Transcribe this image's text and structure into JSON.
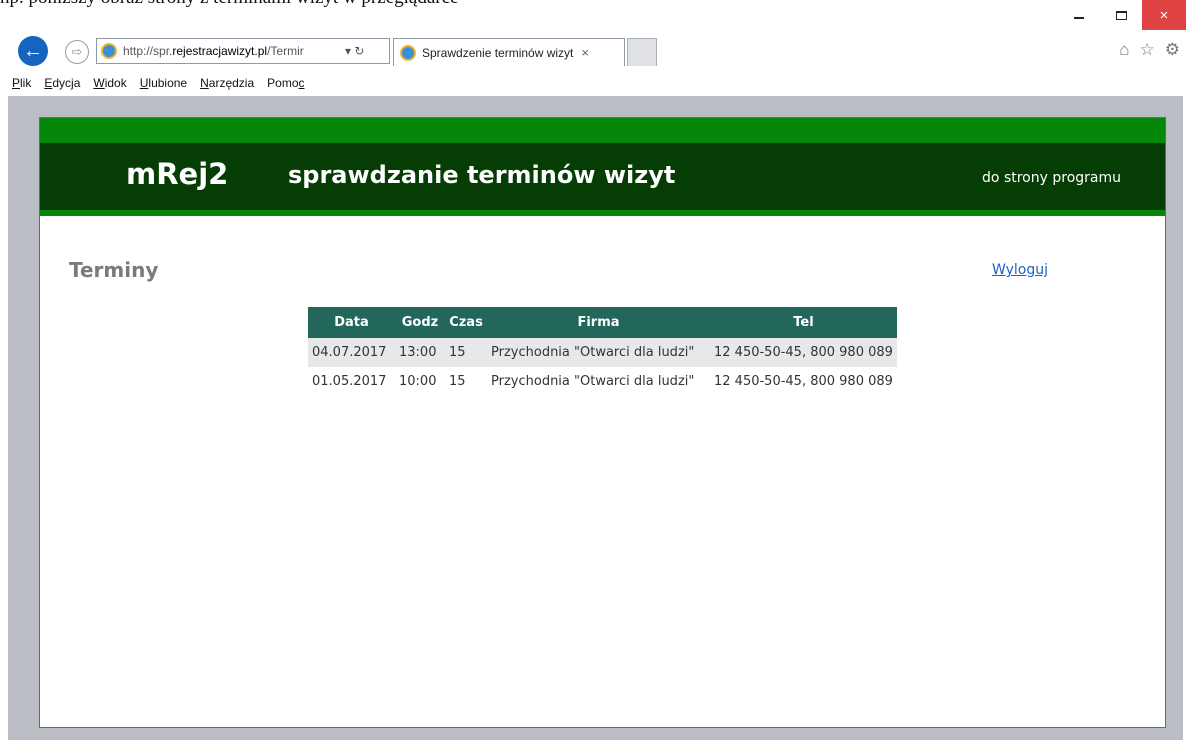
{
  "doc_caption": "np. poniższy obraz strony z terminami wizyt w przeglądarce",
  "browser": {
    "url_prefix": "http://spr.",
    "url_domain": "rejestracjawizyt.pl",
    "url_suffix": "/Termir",
    "address_icons": "▾ ↻",
    "tab_title": "Sprawdzenie terminów wizyt",
    "tab_close": "×",
    "window_close": "×",
    "menu": [
      {
        "pre": "",
        "key": "P",
        "post": "lik"
      },
      {
        "pre": "",
        "key": "E",
        "post": "dycja"
      },
      {
        "pre": "",
        "key": "W",
        "post": "idok"
      },
      {
        "pre": "",
        "key": "U",
        "post": "lubione"
      },
      {
        "pre": "",
        "key": "N",
        "post": "arzędzia"
      },
      {
        "pre": "Pomo",
        "key": "c",
        "post": ""
      }
    ],
    "toolbar_icons": [
      "home-icon",
      "favorites-star-icon",
      "settings-gear-icon"
    ]
  },
  "page": {
    "logo": "mRej2",
    "subtitle": "sprawdzanie terminów wizyt",
    "program_link": "do strony programu",
    "section_title": "Terminy",
    "logout_link": "Wyloguj",
    "table": {
      "headers": [
        "Data",
        "Godz",
        "Czas",
        "Firma",
        "Tel"
      ],
      "rows": [
        [
          "04.07.2017",
          "13:00",
          "15",
          "Przychodnia \"Otwarci dla ludzi\"",
          "12 450-50-45, 800 980 089"
        ],
        [
          "01.05.2017",
          "10:00",
          "15",
          "Przychodnia \"Otwarci dla ludzi\"",
          "12 450-50-45, 800 980 089"
        ]
      ]
    }
  },
  "colors": {
    "header_bright_green": "#05870a",
    "header_dark_green": "#053d05",
    "table_header": "#23665a",
    "link_blue": "#1a64c8"
  }
}
